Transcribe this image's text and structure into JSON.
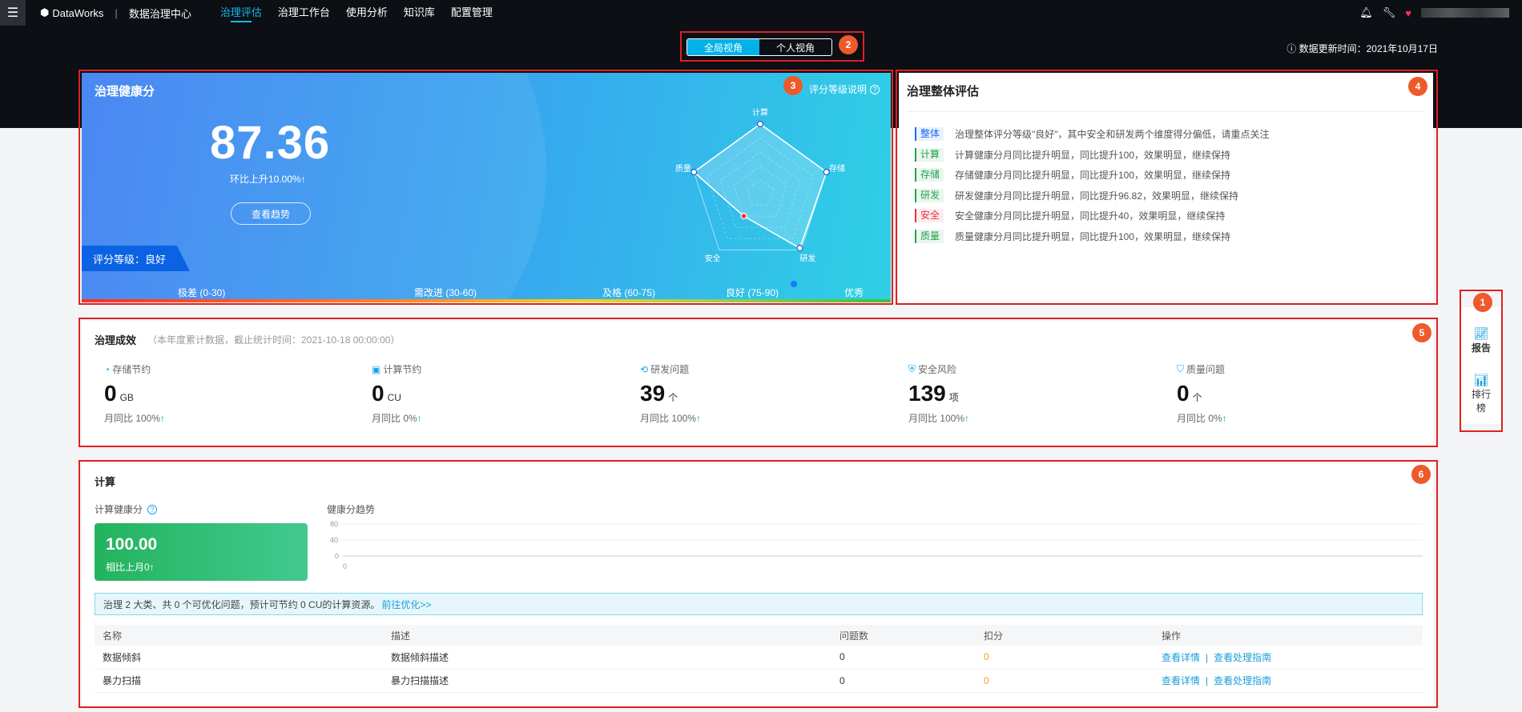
{
  "topbar": {
    "menu_icon": "hamburger-icon",
    "product": "DataWorks",
    "module": "数据治理中心",
    "nav": [
      "治理评估",
      "治理工作台",
      "使用分析",
      "知识库",
      "配置管理"
    ],
    "active_nav": "治理评估",
    "icons": [
      "bell-icon",
      "wrench-icon",
      "heart-icon"
    ]
  },
  "view_switch": {
    "global": "全局视角",
    "personal": "个人视角",
    "selected": "全局视角"
  },
  "update_time": "数据更新时间：2021年10月17日",
  "health": {
    "title": "治理健康分",
    "score": "87.36",
    "mom": "环比上升10.00%↑",
    "trend_button": "查看趋势",
    "grade": "评分等级：良好",
    "grade_desc": "评分等级说明",
    "scale": [
      "极差 (0-30)",
      "需改进 (30-60)",
      "及格 (60-75)",
      "良好 (75-90)",
      "优秀"
    ],
    "radar": {
      "axes": [
        "计算",
        "存储",
        "研发",
        "安全",
        "质量"
      ],
      "values": [
        100,
        100,
        96.82,
        40,
        100
      ],
      "max": 100
    }
  },
  "evaluation": {
    "title": "治理整体评估",
    "rows": [
      {
        "tag": "整体",
        "color": "#1a6fe8",
        "text": "治理整体评分等级\"良好\"，其中安全和研发两个维度得分偏低，请重点关注"
      },
      {
        "tag": "计算",
        "color": "#1fa34a",
        "text": "计算健康分月同比提升明显，同比提升100，效果明显，继续保持"
      },
      {
        "tag": "存储",
        "color": "#1fa34a",
        "text": "存储健康分月同比提升明显，同比提升100，效果明显，继续保持"
      },
      {
        "tag": "研发",
        "color": "#1fa34a",
        "text": "研发健康分月同比提升明显，同比提升96.82，效果明显，继续保持"
      },
      {
        "tag": "安全",
        "color": "#e8323b",
        "text": "安全健康分月同比提升明显，同比提升40，效果明显，继续保持"
      },
      {
        "tag": "质量",
        "color": "#1fa34a",
        "text": "质量健康分月同比提升明显，同比提升100，效果明显，继续保持"
      }
    ]
  },
  "effect": {
    "title": "治理成效",
    "subtitle": "（本年度累计数据，截止统计时间：2021-10-18 00:00:00）",
    "metrics": [
      {
        "label": "存储节约",
        "icon": "storage-icon",
        "value": "0",
        "unit": "GB",
        "cmp": "月同比 100%"
      },
      {
        "label": "计算节约",
        "icon": "compute-icon",
        "value": "0",
        "unit": "CU",
        "cmp": "月同比 0%"
      },
      {
        "label": "研发问题",
        "icon": "dev-icon",
        "value": "39",
        "unit": "个",
        "cmp": "月同比 100%"
      },
      {
        "label": "安全风险",
        "icon": "shield-icon",
        "value": "139",
        "unit": "项",
        "cmp": "月同比 100%"
      },
      {
        "label": "质量问题",
        "icon": "quality-icon",
        "value": "0",
        "unit": "个",
        "cmp": "月同比 0%"
      }
    ]
  },
  "compute": {
    "title": "计算",
    "score_label": "计算健康分",
    "score": "100.00",
    "score_cmp": "相比上月0↑",
    "trend_label": "健康分趋势",
    "trend_yticks": [
      "80",
      "40",
      "0"
    ],
    "trend_x": "0",
    "notice": "治理 2 大类、共 0 个可优化问题，预计可节约 0 CU的计算资源。",
    "notice_link": "前往优化>>",
    "table": {
      "headers": [
        "名称",
        "描述",
        "问题数",
        "扣分",
        "操作"
      ],
      "rows": [
        {
          "name": "数据倾斜",
          "desc": "数据倾斜描述",
          "count": "0",
          "deduct": "0",
          "action1": "查看详情",
          "action2": "查看处理指南"
        },
        {
          "name": "暴力扫描",
          "desc": "暴力扫描描述",
          "count": "0",
          "deduct": "0",
          "action1": "查看详情",
          "action2": "查看处理指南"
        }
      ]
    }
  },
  "side": {
    "report": "报告",
    "rank": "排行榜"
  },
  "annotations": [
    "1",
    "2",
    "3",
    "4",
    "5",
    "6"
  ]
}
